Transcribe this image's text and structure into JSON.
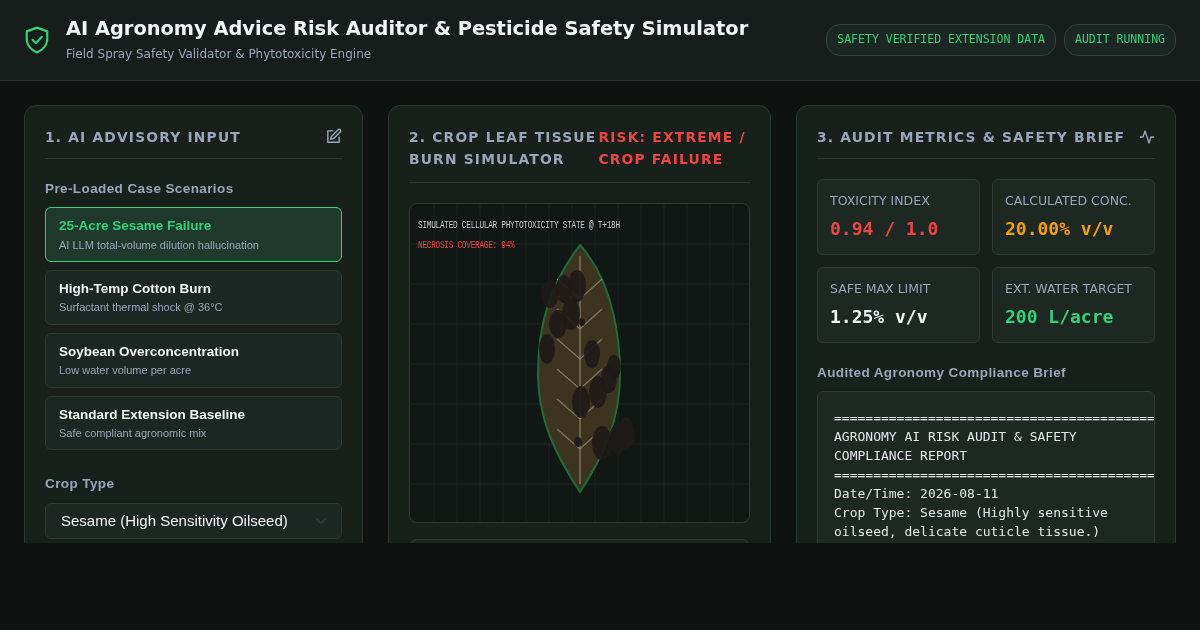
{
  "header": {
    "title": "AI Agronomy Advice Risk Auditor & Pesticide Safety Simulator",
    "subtitle": "Field Spray Safety Validator & Phytotoxicity Engine",
    "badges": [
      "SAFETY VERIFIED EXTENSION DATA",
      "AUDIT RUNNING"
    ]
  },
  "input_panel": {
    "title": "1. AI ADVISORY INPUT",
    "scenarios_label": "Pre-Loaded Case Scenarios",
    "scenarios": [
      {
        "title": "25-Acre Sesame Failure",
        "subtitle": "AI LLM total-volume dilution hallucination",
        "selected": true
      },
      {
        "title": "High-Temp Cotton Burn",
        "subtitle": "Surfactant thermal shock @ 36°C",
        "selected": false
      },
      {
        "title": "Soybean Overconcentration",
        "subtitle": "Low water volume per acre",
        "selected": false
      },
      {
        "title": "Standard Extension Baseline",
        "subtitle": "Safe compliant agronomic mix",
        "selected": false
      }
    ],
    "crop_label": "Crop Type",
    "crop_value": "Sesame (High Sensitivity Oilseed)"
  },
  "simulator_panel": {
    "title": "2. CROP LEAF TISSUE BURN SIMULATOR",
    "risk": "RISK: EXTREME / CROP FAILURE",
    "state_label": "SIMULATED CELLULAR PHYTOTOXICITY STATE @ T+18H",
    "necrosis_label": "NECROSIS COVERAGE: 94%"
  },
  "metrics_panel": {
    "title": "3. AUDIT METRICS & SAFETY BRIEF",
    "metrics": [
      {
        "label": "TOXICITY INDEX",
        "value": "0.94 / 1.0",
        "color": "#ef4444"
      },
      {
        "label": "CALCULATED CONC.",
        "value": "20.00% v/v",
        "color": "#f59e0b"
      },
      {
        "label": "SAFE MAX LIMIT",
        "value": "1.25% v/v",
        "color": "#f3f4f6"
      },
      {
        "label": "EXT. WATER TARGET",
        "value": "200 L/acre",
        "color": "#34d17a"
      }
    ],
    "brief_label": "Audited Agronomy Compliance Brief",
    "report_lines": [
      "=========================================",
      "AGRONOMY AI RISK AUDIT & SAFETY COMPLIANCE REPORT",
      "=========================================",
      "Date/Time: 2026-08-11",
      "Crop Type: Sesame (Highly sensitive oilseed, delicate cuticle tissue.)"
    ]
  }
}
